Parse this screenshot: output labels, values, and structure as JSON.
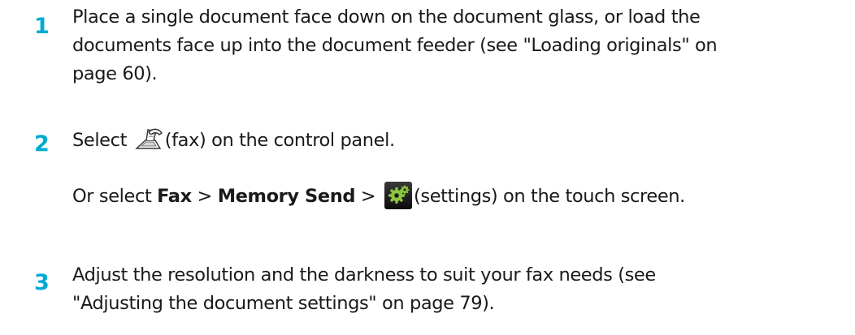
{
  "steps": [
    {
      "number": "1",
      "line1": "Place a single document face down on the document glass, or load the",
      "line2": "documents face up into the document feeder (see \"Loading originals\" on",
      "line3": "page 60)."
    },
    {
      "number": "2",
      "select_prefix": "Select",
      "fax_suffix": "(fax) on the control panel.",
      "or_select": "Or select",
      "fax_bold": "Fax",
      "sep1": ">",
      "memory_bold": "Memory Send",
      "sep2": ">",
      "settings_suffix": "(settings) on the touch screen.",
      "icons": [
        "fax-icon",
        "gear-icon"
      ]
    },
    {
      "number": "3",
      "line1": "Adjust the resolution and the darkness to suit your fax needs (see",
      "line2": "\"Adjusting the document settings\" on page 79)."
    }
  ],
  "colors": {
    "step_number": "#00aad2",
    "text": "#1a1a1a"
  }
}
